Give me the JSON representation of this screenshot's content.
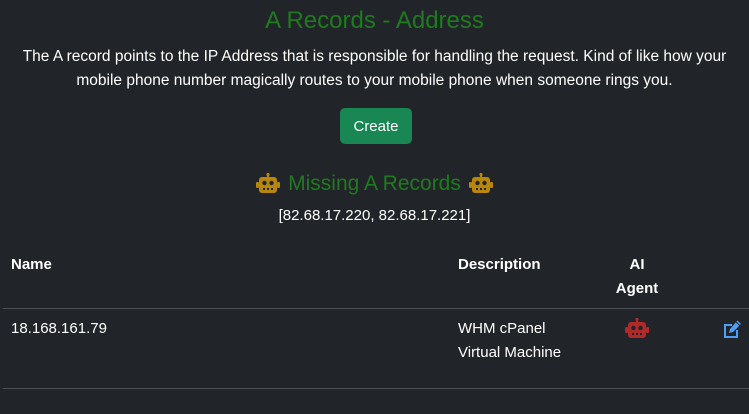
{
  "header": {
    "title": "A Records - Address",
    "description_line1": "The A record points to the IP Address that is responsible for handling the request. Kind of like how your",
    "description_line2": "mobile phone number magically routes to your mobile phone when someone rings you."
  },
  "actions": {
    "create_label": "Create"
  },
  "missing": {
    "label": "Missing A Records",
    "ips": "[82.68.17.220, 82.68.17.221]",
    "icon": "robot-icon",
    "icon_color": "#b8860b"
  },
  "table": {
    "headers": {
      "name": "Name",
      "description": "Description",
      "ai_line1": "AI",
      "ai_line2": "Agent"
    },
    "rows": [
      {
        "name": "18.168.161.79",
        "description_line1": "WHM cPanel",
        "description_line2": "Virtual Machine",
        "agent_icon": "robot-icon",
        "agent_icon_color": "#b02a2a",
        "edit_icon": "edit-icon"
      }
    ]
  },
  "colors": {
    "background": "#212529",
    "title_green": "#1f7a1f",
    "button_green": "#198754",
    "edit_blue": "#4d9ef7"
  }
}
